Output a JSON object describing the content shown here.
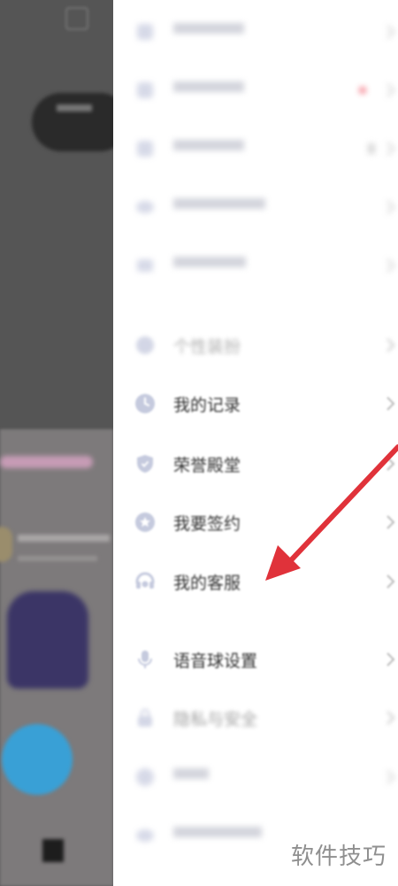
{
  "drawer": {
    "items": [
      {
        "label": "",
        "icon": "blurred-icon"
      },
      {
        "label": "",
        "icon": "blurred-icon",
        "badge": true
      },
      {
        "label": "",
        "icon": "blurred-icon"
      },
      {
        "label": "",
        "icon": "blurred-icon"
      },
      {
        "label": "",
        "icon": "blurred-icon"
      },
      {
        "label": "个性装扮",
        "icon": "palette-icon"
      },
      {
        "label": "我的记录",
        "icon": "clock-icon"
      },
      {
        "label": "荣誉殿堂",
        "icon": "shield-icon"
      },
      {
        "label": "我要签约",
        "icon": "star-badge-icon"
      },
      {
        "label": "我的客服",
        "icon": "headset-icon"
      },
      {
        "label": "语音球设置",
        "icon": "microphone-icon"
      },
      {
        "label": "隐私与安全",
        "icon": "lock-icon"
      },
      {
        "label": "",
        "icon": "blurred-icon"
      },
      {
        "label": "",
        "icon": "blurred-icon"
      }
    ]
  },
  "watermark": "软件技巧",
  "colors": {
    "icon": "#c9cde0",
    "text": "#333333",
    "arrow": "#e0323a",
    "overlay": "#555555"
  }
}
